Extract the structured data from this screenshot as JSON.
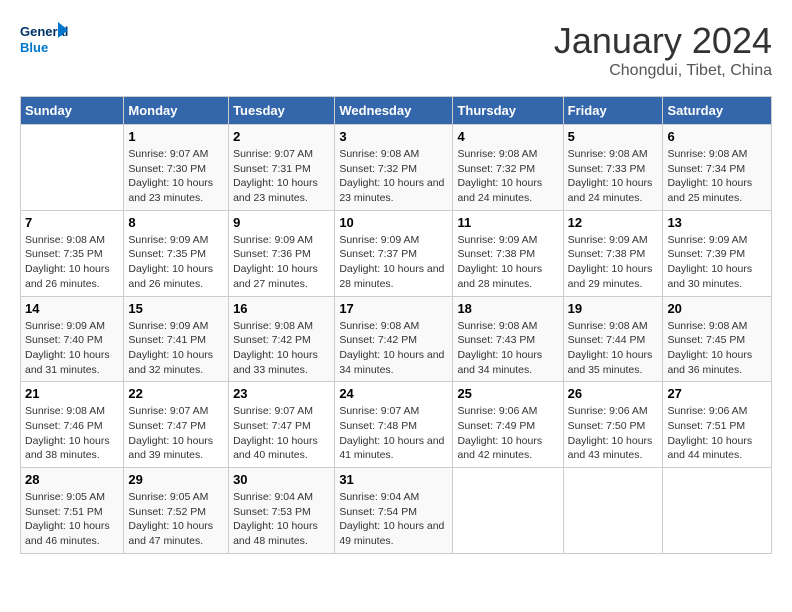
{
  "header": {
    "logo_line1": "General",
    "logo_line2": "Blue",
    "main_title": "January 2024",
    "subtitle": "Chongdui, Tibet, China"
  },
  "days_of_week": [
    "Sunday",
    "Monday",
    "Tuesday",
    "Wednesday",
    "Thursday",
    "Friday",
    "Saturday"
  ],
  "weeks": [
    [
      {
        "day": "",
        "sunrise": "",
        "sunset": "",
        "daylight": ""
      },
      {
        "day": "1",
        "sunrise": "Sunrise: 9:07 AM",
        "sunset": "Sunset: 7:30 PM",
        "daylight": "Daylight: 10 hours and 23 minutes."
      },
      {
        "day": "2",
        "sunrise": "Sunrise: 9:07 AM",
        "sunset": "Sunset: 7:31 PM",
        "daylight": "Daylight: 10 hours and 23 minutes."
      },
      {
        "day": "3",
        "sunrise": "Sunrise: 9:08 AM",
        "sunset": "Sunset: 7:32 PM",
        "daylight": "Daylight: 10 hours and 23 minutes."
      },
      {
        "day": "4",
        "sunrise": "Sunrise: 9:08 AM",
        "sunset": "Sunset: 7:32 PM",
        "daylight": "Daylight: 10 hours and 24 minutes."
      },
      {
        "day": "5",
        "sunrise": "Sunrise: 9:08 AM",
        "sunset": "Sunset: 7:33 PM",
        "daylight": "Daylight: 10 hours and 24 minutes."
      },
      {
        "day": "6",
        "sunrise": "Sunrise: 9:08 AM",
        "sunset": "Sunset: 7:34 PM",
        "daylight": "Daylight: 10 hours and 25 minutes."
      }
    ],
    [
      {
        "day": "7",
        "sunrise": "Sunrise: 9:08 AM",
        "sunset": "Sunset: 7:35 PM",
        "daylight": "Daylight: 10 hours and 26 minutes."
      },
      {
        "day": "8",
        "sunrise": "Sunrise: 9:09 AM",
        "sunset": "Sunset: 7:35 PM",
        "daylight": "Daylight: 10 hours and 26 minutes."
      },
      {
        "day": "9",
        "sunrise": "Sunrise: 9:09 AM",
        "sunset": "Sunset: 7:36 PM",
        "daylight": "Daylight: 10 hours and 27 minutes."
      },
      {
        "day": "10",
        "sunrise": "Sunrise: 9:09 AM",
        "sunset": "Sunset: 7:37 PM",
        "daylight": "Daylight: 10 hours and 28 minutes."
      },
      {
        "day": "11",
        "sunrise": "Sunrise: 9:09 AM",
        "sunset": "Sunset: 7:38 PM",
        "daylight": "Daylight: 10 hours and 28 minutes."
      },
      {
        "day": "12",
        "sunrise": "Sunrise: 9:09 AM",
        "sunset": "Sunset: 7:38 PM",
        "daylight": "Daylight: 10 hours and 29 minutes."
      },
      {
        "day": "13",
        "sunrise": "Sunrise: 9:09 AM",
        "sunset": "Sunset: 7:39 PM",
        "daylight": "Daylight: 10 hours and 30 minutes."
      }
    ],
    [
      {
        "day": "14",
        "sunrise": "Sunrise: 9:09 AM",
        "sunset": "Sunset: 7:40 PM",
        "daylight": "Daylight: 10 hours and 31 minutes."
      },
      {
        "day": "15",
        "sunrise": "Sunrise: 9:09 AM",
        "sunset": "Sunset: 7:41 PM",
        "daylight": "Daylight: 10 hours and 32 minutes."
      },
      {
        "day": "16",
        "sunrise": "Sunrise: 9:08 AM",
        "sunset": "Sunset: 7:42 PM",
        "daylight": "Daylight: 10 hours and 33 minutes."
      },
      {
        "day": "17",
        "sunrise": "Sunrise: 9:08 AM",
        "sunset": "Sunset: 7:42 PM",
        "daylight": "Daylight: 10 hours and 34 minutes."
      },
      {
        "day": "18",
        "sunrise": "Sunrise: 9:08 AM",
        "sunset": "Sunset: 7:43 PM",
        "daylight": "Daylight: 10 hours and 34 minutes."
      },
      {
        "day": "19",
        "sunrise": "Sunrise: 9:08 AM",
        "sunset": "Sunset: 7:44 PM",
        "daylight": "Daylight: 10 hours and 35 minutes."
      },
      {
        "day": "20",
        "sunrise": "Sunrise: 9:08 AM",
        "sunset": "Sunset: 7:45 PM",
        "daylight": "Daylight: 10 hours and 36 minutes."
      }
    ],
    [
      {
        "day": "21",
        "sunrise": "Sunrise: 9:08 AM",
        "sunset": "Sunset: 7:46 PM",
        "daylight": "Daylight: 10 hours and 38 minutes."
      },
      {
        "day": "22",
        "sunrise": "Sunrise: 9:07 AM",
        "sunset": "Sunset: 7:47 PM",
        "daylight": "Daylight: 10 hours and 39 minutes."
      },
      {
        "day": "23",
        "sunrise": "Sunrise: 9:07 AM",
        "sunset": "Sunset: 7:47 PM",
        "daylight": "Daylight: 10 hours and 40 minutes."
      },
      {
        "day": "24",
        "sunrise": "Sunrise: 9:07 AM",
        "sunset": "Sunset: 7:48 PM",
        "daylight": "Daylight: 10 hours and 41 minutes."
      },
      {
        "day": "25",
        "sunrise": "Sunrise: 9:06 AM",
        "sunset": "Sunset: 7:49 PM",
        "daylight": "Daylight: 10 hours and 42 minutes."
      },
      {
        "day": "26",
        "sunrise": "Sunrise: 9:06 AM",
        "sunset": "Sunset: 7:50 PM",
        "daylight": "Daylight: 10 hours and 43 minutes."
      },
      {
        "day": "27",
        "sunrise": "Sunrise: 9:06 AM",
        "sunset": "Sunset: 7:51 PM",
        "daylight": "Daylight: 10 hours and 44 minutes."
      }
    ],
    [
      {
        "day": "28",
        "sunrise": "Sunrise: 9:05 AM",
        "sunset": "Sunset: 7:51 PM",
        "daylight": "Daylight: 10 hours and 46 minutes."
      },
      {
        "day": "29",
        "sunrise": "Sunrise: 9:05 AM",
        "sunset": "Sunset: 7:52 PM",
        "daylight": "Daylight: 10 hours and 47 minutes."
      },
      {
        "day": "30",
        "sunrise": "Sunrise: 9:04 AM",
        "sunset": "Sunset: 7:53 PM",
        "daylight": "Daylight: 10 hours and 48 minutes."
      },
      {
        "day": "31",
        "sunrise": "Sunrise: 9:04 AM",
        "sunset": "Sunset: 7:54 PM",
        "daylight": "Daylight: 10 hours and 49 minutes."
      },
      {
        "day": "",
        "sunrise": "",
        "sunset": "",
        "daylight": ""
      },
      {
        "day": "",
        "sunrise": "",
        "sunset": "",
        "daylight": ""
      },
      {
        "day": "",
        "sunrise": "",
        "sunset": "",
        "daylight": ""
      }
    ]
  ]
}
